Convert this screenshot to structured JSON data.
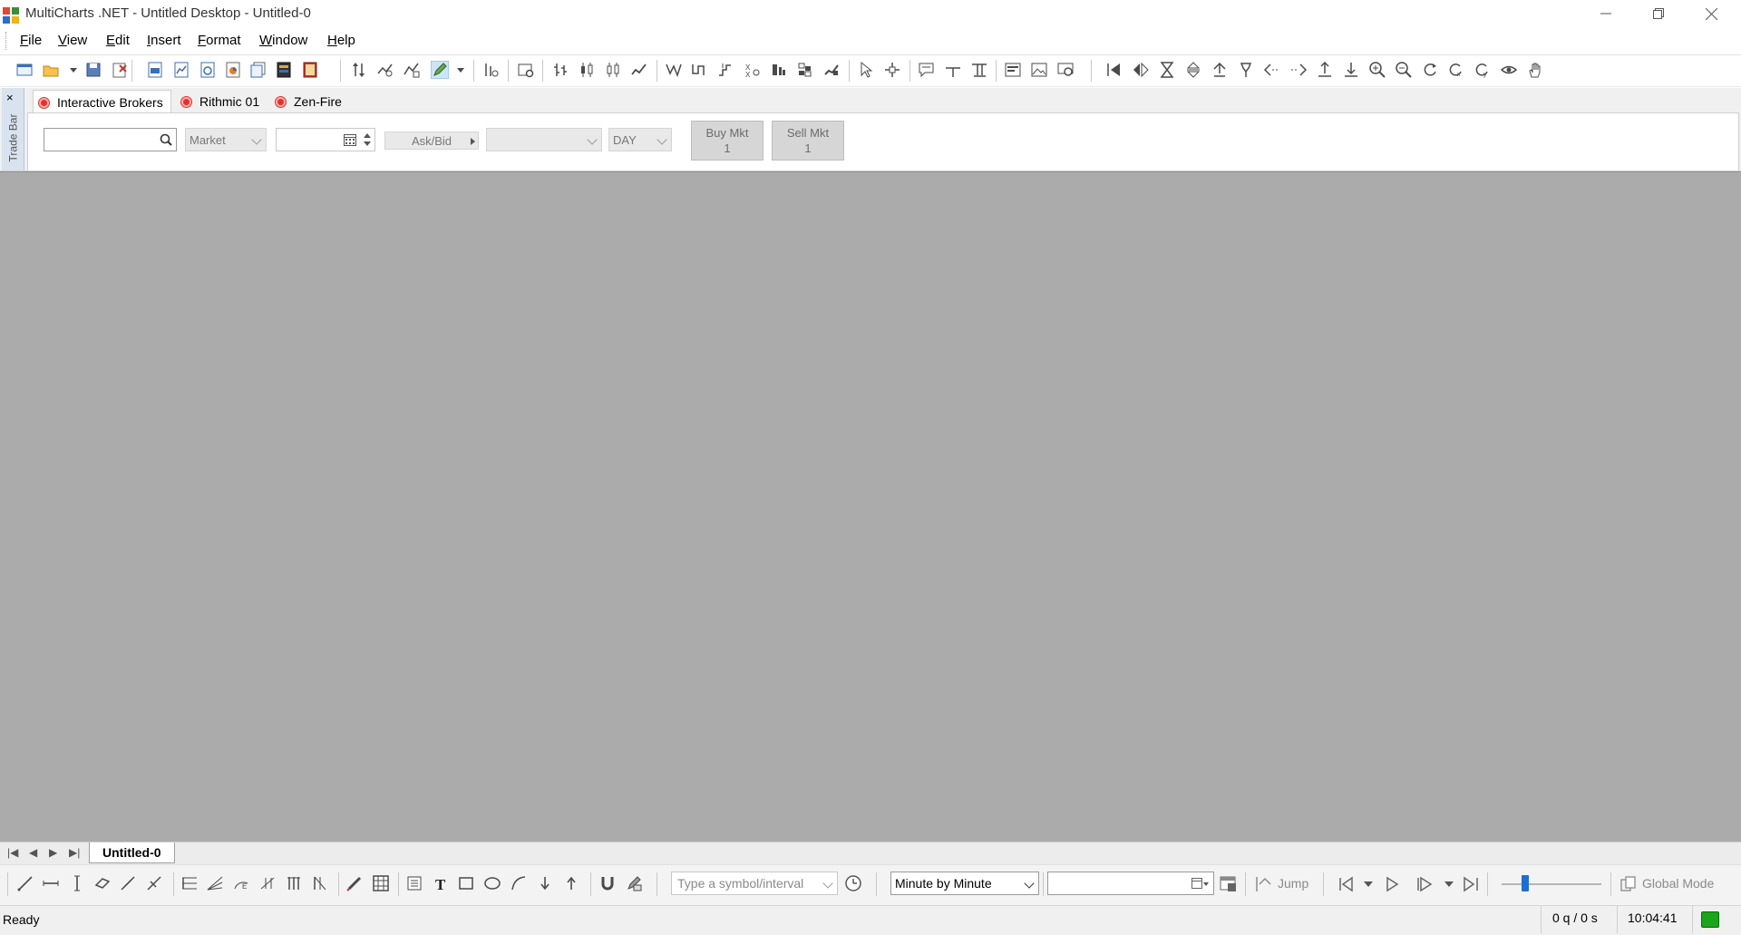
{
  "window": {
    "title": "MultiCharts .NET - Untitled Desktop - Untitled-0",
    "controls": [
      "minimize",
      "restore",
      "close"
    ]
  },
  "menu": [
    {
      "label": "File",
      "underline": "F",
      "rest": "ile"
    },
    {
      "label": "View",
      "underline": "V",
      "rest": "iew"
    },
    {
      "label": "Edit",
      "underline": "E",
      "rest": "dit"
    },
    {
      "label": "Insert",
      "underline": "I",
      "rest": "nsert"
    },
    {
      "label": "Format",
      "underline": "F",
      "rest": "ormat"
    },
    {
      "label": "Window",
      "underline": "W",
      "rest": "indow"
    },
    {
      "label": "Help",
      "underline": "H",
      "rest": "elp"
    }
  ],
  "tradebar": {
    "label": "Trade Bar",
    "close_glyph": "×",
    "tabs": [
      {
        "label": "Interactive Brokers",
        "active": true
      },
      {
        "label": "Rithmic 01",
        "active": false
      },
      {
        "label": "Zen-Fire",
        "active": false
      }
    ],
    "symbol_input": "",
    "order_type": "Market",
    "quantity": "",
    "price_mode": "Ask/Bid",
    "account": "",
    "tif": "DAY",
    "buy": {
      "label": "Buy Mkt",
      "qty": "1"
    },
    "sell": {
      "label": "Sell Mkt",
      "qty": "1"
    }
  },
  "sheets": {
    "active": "Untitled-0"
  },
  "drawing_toolbar": {
    "symbol_placeholder": "Type a symbol/interval",
    "resolution": "Minute by Minute",
    "date_value": "",
    "jump_label": "Jump",
    "global_mode_label": "Global Mode",
    "zoom_level": 0.2
  },
  "status": {
    "text": "Ready",
    "quotes": "0 q / 0 s",
    "time": "10:04:41",
    "connection": "connected"
  },
  "colors": {
    "workspace": "#ababab",
    "record_dot": "#e8302a",
    "connected": "#1aa51a",
    "slider_thumb": "#1e6fd0"
  }
}
